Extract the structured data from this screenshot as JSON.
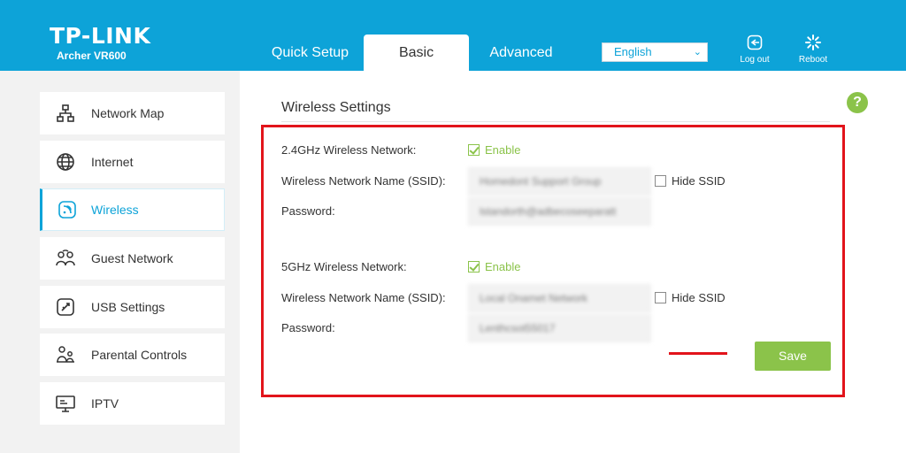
{
  "header": {
    "brand": "TP-LINK",
    "model": "Archer VR600",
    "tabs": [
      {
        "label": "Quick Setup",
        "active": false
      },
      {
        "label": "Basic",
        "active": true
      },
      {
        "label": "Advanced",
        "active": false
      }
    ],
    "language": {
      "selected": "English"
    },
    "logout_label": "Log out",
    "reboot_label": "Reboot"
  },
  "sidebar": {
    "items": [
      {
        "label": "Network Map",
        "icon": "network-map-icon",
        "active": false
      },
      {
        "label": "Internet",
        "icon": "globe-icon",
        "active": false
      },
      {
        "label": "Wireless",
        "icon": "wireless-icon",
        "active": true
      },
      {
        "label": "Guest Network",
        "icon": "guest-network-icon",
        "active": false
      },
      {
        "label": "USB Settings",
        "icon": "usb-icon",
        "active": false
      },
      {
        "label": "Parental Controls",
        "icon": "parental-controls-icon",
        "active": false
      },
      {
        "label": "IPTV",
        "icon": "iptv-icon",
        "active": false
      }
    ]
  },
  "main": {
    "help_glyph": "?",
    "section_title": "Wireless Settings",
    "band24": {
      "label": "2.4GHz Wireless Network:",
      "enable_label": "Enable",
      "enabled": true,
      "ssid_label": "Wireless Network Name (SSID):",
      "ssid_value": "Homedont Support Group",
      "hide_ssid_label": "Hide SSID",
      "hide_ssid_checked": false,
      "password_label": "Password:",
      "password_value": "lstandorth@adbecoseeparatt"
    },
    "band5": {
      "label": "5GHz Wireless Network:",
      "enable_label": "Enable",
      "enabled": true,
      "ssid_label": "Wireless Network Name (SSID):",
      "ssid_value": "Local Onamet Network",
      "hide_ssid_label": "Hide SSID",
      "hide_ssid_checked": false,
      "password_label": "Password:",
      "password_value": "Lenthcsot55017"
    },
    "save_label": "Save"
  },
  "colors": {
    "brand_blue": "#0da3d8",
    "accent_green": "#8bc34a",
    "highlight_red": "#e2141b"
  }
}
